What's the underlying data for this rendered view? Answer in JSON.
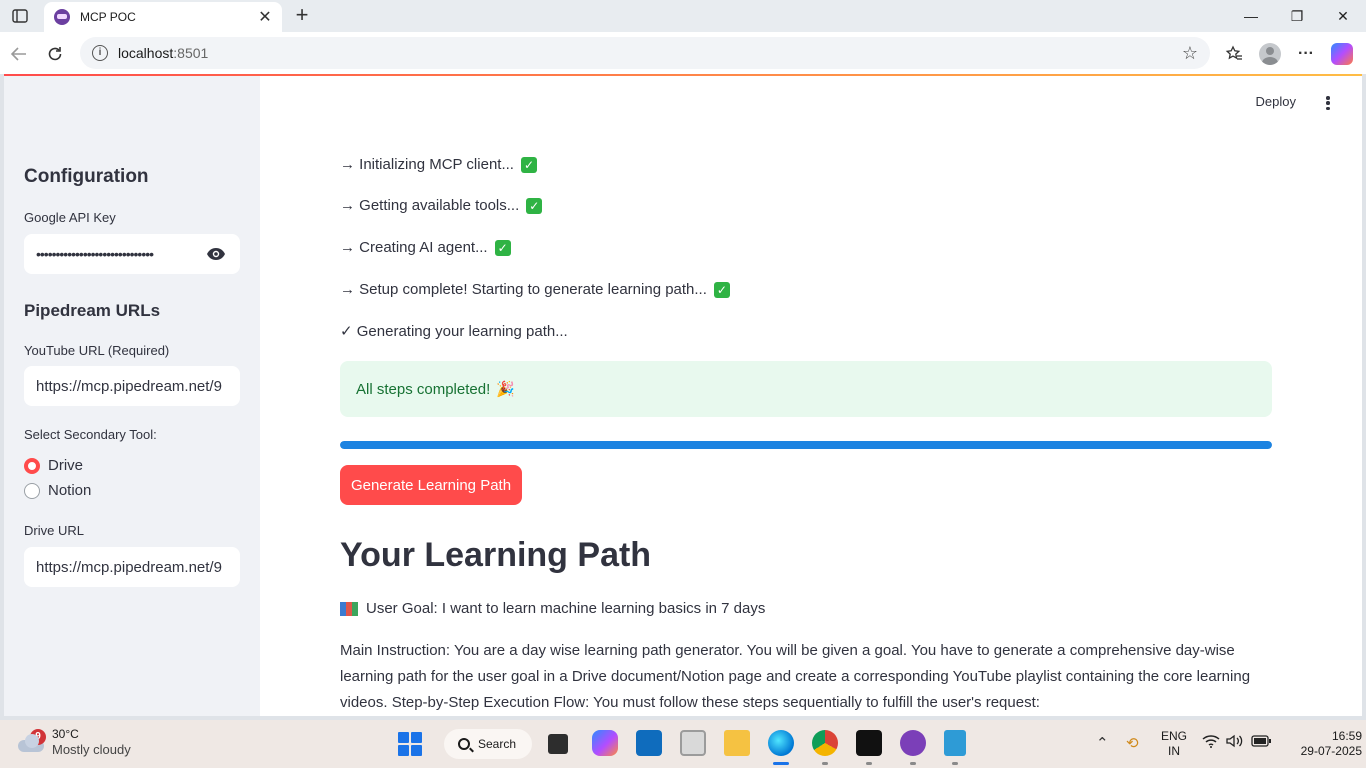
{
  "browser": {
    "tab_title": "MCP POC",
    "tab_close": "✕",
    "new_tab": "+",
    "url_host": "localhost",
    "url_port": ":8501",
    "window_minimize": "—",
    "window_restore": "❐",
    "window_close": "✕"
  },
  "sidebar": {
    "config_heading": "Configuration",
    "api_key_label": "Google API Key",
    "api_key_masked": "••••••••••••••••••••••••••••••",
    "pipedream_heading": "Pipedream URLs",
    "youtube_label": "YouTube URL (Required)",
    "youtube_value": "https://mcp.pipedream.net/9",
    "secondary_label": "Select Secondary Tool:",
    "options": [
      {
        "label": "Drive",
        "selected": true
      },
      {
        "label": "Notion",
        "selected": false
      }
    ],
    "drive_label": "Drive URL",
    "drive_value": "https://mcp.pipedream.net/9"
  },
  "main": {
    "deploy_label": "Deploy",
    "steps": [
      {
        "prefix": "→",
        "text": "Initializing MCP client...",
        "done": true
      },
      {
        "prefix": "→",
        "text": "Getting available tools...",
        "done": true
      },
      {
        "prefix": "→",
        "text": "Creating AI agent...",
        "done": true
      },
      {
        "prefix": "→",
        "text": "Setup complete! Starting to generate learning path...",
        "done": true
      },
      {
        "prefix": "✓",
        "text": "Generating your learning path...",
        "done": false
      }
    ],
    "success_message": "All steps completed!",
    "party_icon": "🎉",
    "progress_percent": 100,
    "generate_button": "Generate Learning Path",
    "section_heading": "Your Learning Path",
    "user_goal": "User Goal: I want to learn machine learning basics in 7 days",
    "instruction_text": "Main Instruction: You are a day wise learning path generator. You will be given a goal. You have to generate a comprehensive day-wise learning path for the user goal in a Drive document/Notion page and create a corresponding YouTube playlist containing the core learning videos. Step-by-Step Execution Flow: You must follow these steps sequentially to fulfill the user's request:"
  },
  "taskbar": {
    "weather_badge": "9",
    "temperature": "30°C",
    "condition": "Mostly cloudy",
    "search_label": "Search",
    "lang_top": "ENG",
    "lang_bottom": "IN",
    "time": "16:59",
    "date": "29-07-2025"
  },
  "colors": {
    "accent": "#ff4b4b",
    "progress": "#1c83e1",
    "success_bg": "#e8f9ee",
    "success_text": "#177233",
    "sidebar_bg": "#f0f2f6"
  }
}
